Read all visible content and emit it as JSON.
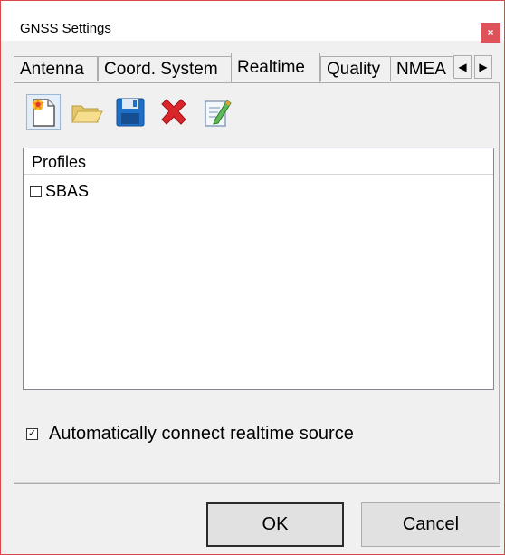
{
  "window": {
    "title": "GNSS Settings",
    "close_glyph": "×"
  },
  "tabs": [
    {
      "label": "Antenna",
      "active": false
    },
    {
      "label": "Coord. System",
      "active": false
    },
    {
      "label": "Realtime",
      "active": true
    },
    {
      "label": "Quality",
      "active": false
    },
    {
      "label": "NMEA",
      "active": false
    }
  ],
  "tab_scroll": {
    "left_glyph": "◀",
    "right_glyph": "▶"
  },
  "toolbar": {
    "items": [
      {
        "icon": "new-profile-icon"
      },
      {
        "icon": "open-folder-icon"
      },
      {
        "icon": "save-icon"
      },
      {
        "icon": "delete-icon"
      },
      {
        "icon": "edit-icon"
      }
    ]
  },
  "profiles": {
    "header": "Profiles",
    "items": [
      {
        "label": "SBAS",
        "checked": false
      }
    ]
  },
  "auto_connect": {
    "label": "Automatically connect realtime source",
    "checked": true,
    "check_glyph": "✓"
  },
  "buttons": {
    "ok": "OK",
    "cancel": "Cancel"
  },
  "colors": {
    "close_bg": "#e0525a",
    "window_border": "#d9474b",
    "accent_blue": "#1e6fc8",
    "delete_red": "#d9262b"
  }
}
